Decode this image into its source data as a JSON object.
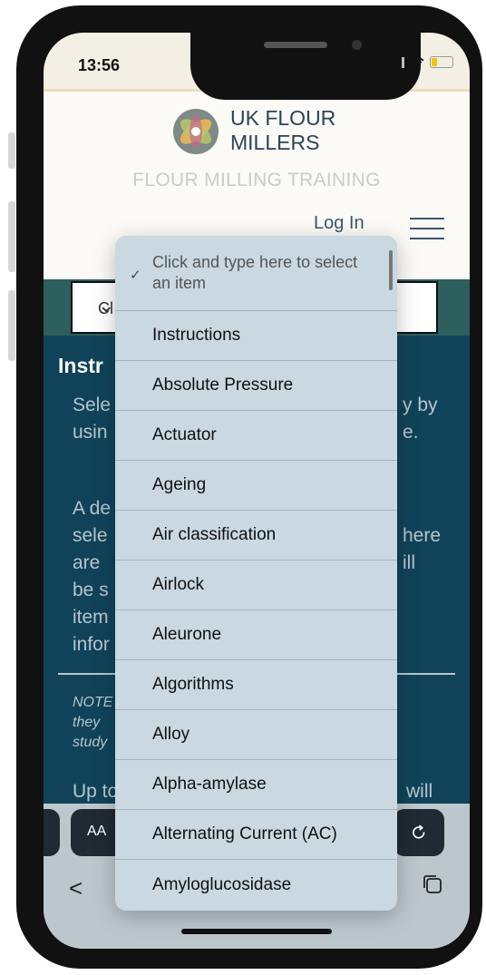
{
  "status_bar": {
    "time": "13:56"
  },
  "site": {
    "brand_line1": "UK FLOUR",
    "brand_line2": "MILLERS",
    "tagline": "FLOUR MILLING TRAINING",
    "login_label": "Log In"
  },
  "select": {
    "visible_value": "Cl"
  },
  "content": {
    "title": "Instr",
    "para1_left": [
      "Sele",
      "usin"
    ],
    "para1_right": [
      "y by",
      "e."
    ],
    "para2_left": [
      "A de",
      "sele",
      "are",
      "be s",
      "item",
      "infor"
    ],
    "para2_right": [
      "here",
      "ill"
    ],
    "note_left": [
      "NOTE",
      "they",
      "study"
    ],
    "para3_left": "Up to",
    "para3_right": "will"
  },
  "browser": {
    "aa_label": "AA",
    "reload_icon": "reload-icon",
    "back_label": "<"
  },
  "dropdown": {
    "placeholder": "Click and type here to select an item",
    "items": [
      "Instructions",
      "Absolute Pressure",
      "Actuator",
      "Ageing",
      "Air classification",
      "Airlock",
      "Aleurone",
      "Algorithms",
      "Alloy",
      "Alpha-amylase",
      "Alternating Current (AC)",
      "Amyloglucosidase"
    ]
  },
  "colors": {
    "content_bg": "#10435a",
    "teal_band": "#2c5f5d",
    "dropdown_bg": "#c9d8e1",
    "brand_text": "#2b4457"
  }
}
